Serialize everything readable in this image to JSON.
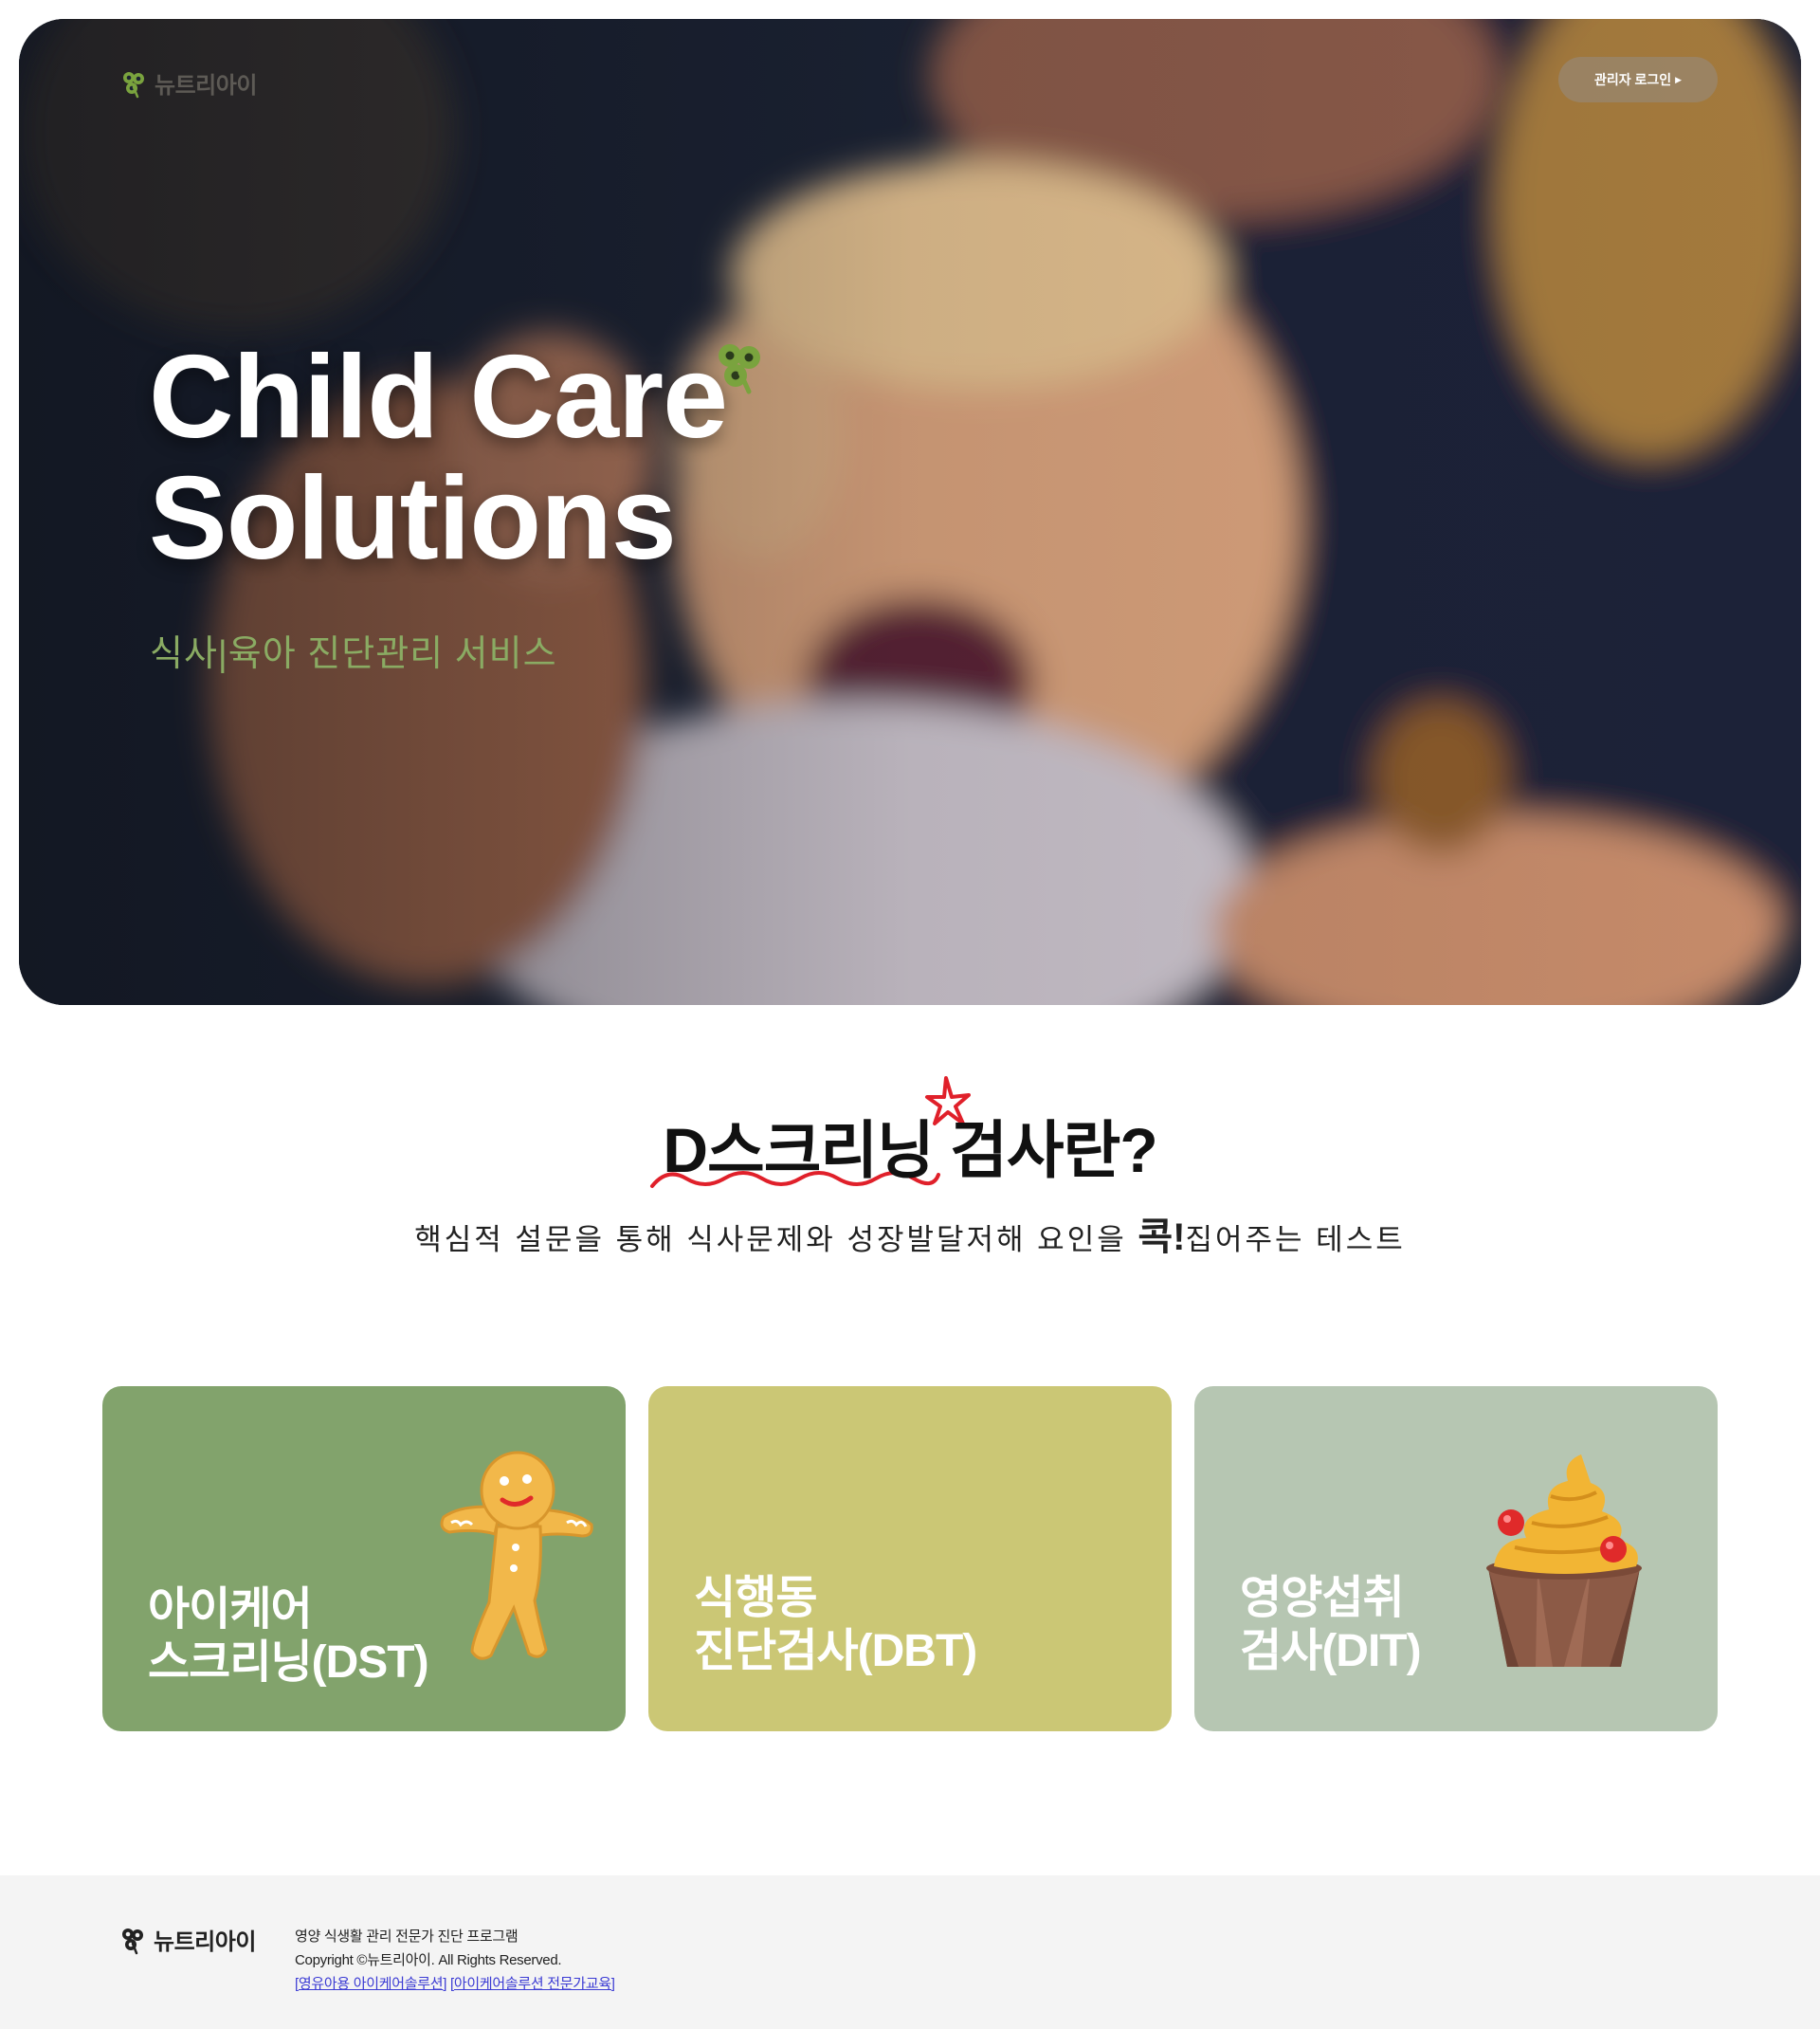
{
  "header": {
    "logo_text": "뉴트리아이",
    "admin_login_label": "관리자 로그인",
    "admin_login_arrow": "▶"
  },
  "hero": {
    "title_line1": "Child Care",
    "title_line2": "Solutions",
    "subtitle": "식사|육아 진단관리 서비스"
  },
  "intro": {
    "title_part1": "D스크리닝",
    "title_part2": " 검사란?",
    "subtitle_before": "핵심적 설문을 통해 식사문제와 성장발달저해 요인을 ",
    "subtitle_emph": "콕!",
    "subtitle_after": "집어주는 테스트"
  },
  "cards": [
    {
      "label": "아이케어\n스크리닝(DST)",
      "color": "#82a36c",
      "icon": "gingerbread-icon"
    },
    {
      "label": "식행동\n진단검사(DBT)",
      "color": "#cbc775",
      "icon": ""
    },
    {
      "label": "영양섭취\n검사(DIT)",
      "color": "#b6c6b2",
      "icon": "cupcake-icon"
    }
  ],
  "footer": {
    "logo_text": "뉴트리아이",
    "line1": "영양 식생활 관리 전문가 진단 프로그램",
    "line2": "Copyright ©뉴트리아이. All Rights Reserved.",
    "link1": "[영유아용 아이케어솔루션]",
    "link2": "[아이케어솔루션 전문가교육]"
  },
  "colors": {
    "brand_green": "#8aab63",
    "card_green": "#82a36c",
    "card_yellow": "#cbc775",
    "card_sage": "#b6c6b2",
    "deco_red": "#e0202a",
    "link_blue": "#3b3bd4"
  }
}
